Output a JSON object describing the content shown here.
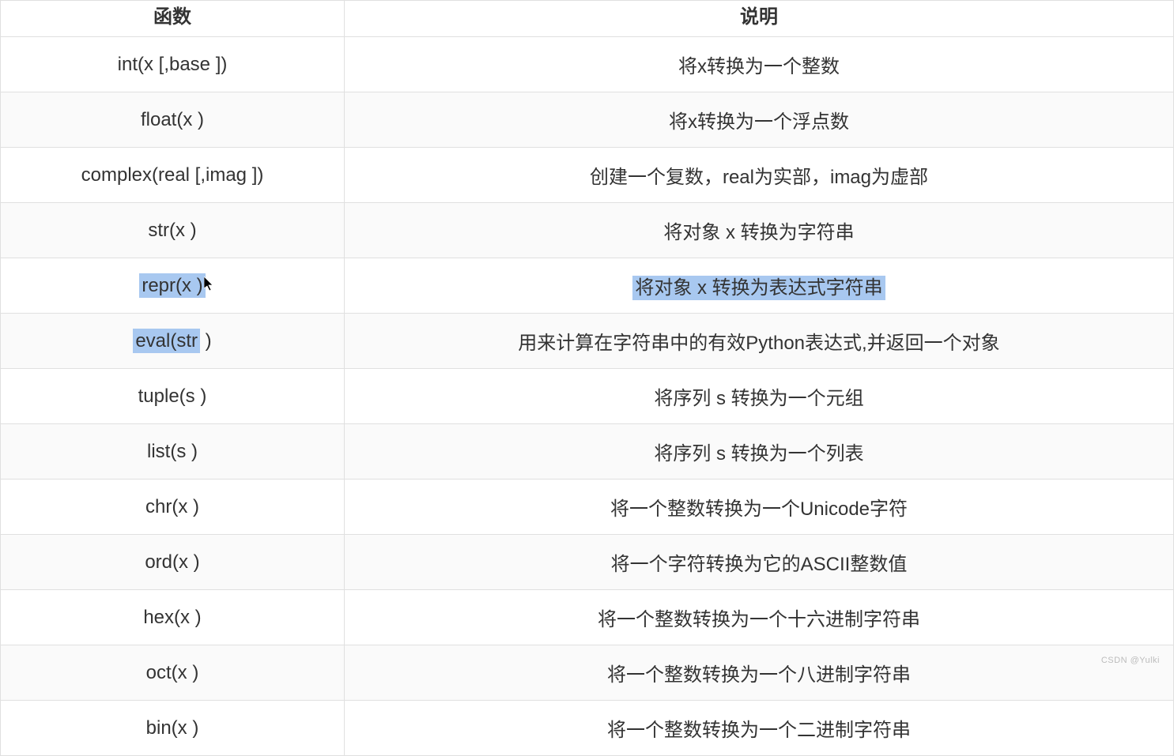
{
  "table": {
    "headers": {
      "function": "函数",
      "description": "说明"
    },
    "rows": [
      {
        "func": "int(x [,base ])",
        "desc": "将x转换为一个整数",
        "highlightFunc": false,
        "highlightDesc": false
      },
      {
        "func": "float(x )",
        "desc": "将x转换为一个浮点数",
        "highlightFunc": false,
        "highlightDesc": false
      },
      {
        "func": "complex(real [,imag ])",
        "desc": "创建一个复数，real为实部，imag为虚部",
        "highlightFunc": false,
        "highlightDesc": false
      },
      {
        "func": "str(x )",
        "desc": "将对象 x 转换为字符串",
        "highlightFunc": false,
        "highlightDesc": false
      },
      {
        "func": "repr(x )",
        "desc": "将对象 x 转换为表达式字符串",
        "highlightFunc": true,
        "highlightDesc": true
      },
      {
        "func": "eval(str )",
        "desc": "用来计算在字符串中的有效Python表达式,并返回一个对象",
        "highlightFunc": true,
        "highlightFuncPartial": "eval(str",
        "highlightFuncRest": " )",
        "highlightDesc": false
      },
      {
        "func": "tuple(s )",
        "desc": "将序列 s 转换为一个元组",
        "highlightFunc": false,
        "highlightDesc": false
      },
      {
        "func": "list(s )",
        "desc": "将序列 s 转换为一个列表",
        "highlightFunc": false,
        "highlightDesc": false
      },
      {
        "func": "chr(x )",
        "desc": "将一个整数转换为一个Unicode字符",
        "highlightFunc": false,
        "highlightDesc": false
      },
      {
        "func": "ord(x )",
        "desc": "将一个字符转换为它的ASCII整数值",
        "highlightFunc": false,
        "highlightDesc": false
      },
      {
        "func": "hex(x )",
        "desc": "将一个整数转换为一个十六进制字符串",
        "highlightFunc": false,
        "highlightDesc": false
      },
      {
        "func": "oct(x )",
        "desc": "将一个整数转换为一个八进制字符串",
        "highlightFunc": false,
        "highlightDesc": false
      },
      {
        "func": "bin(x )",
        "desc": "将一个整数转换为一个二进制字符串",
        "highlightFunc": false,
        "highlightDesc": false
      }
    ]
  },
  "watermark": "CSDN @Yulki"
}
